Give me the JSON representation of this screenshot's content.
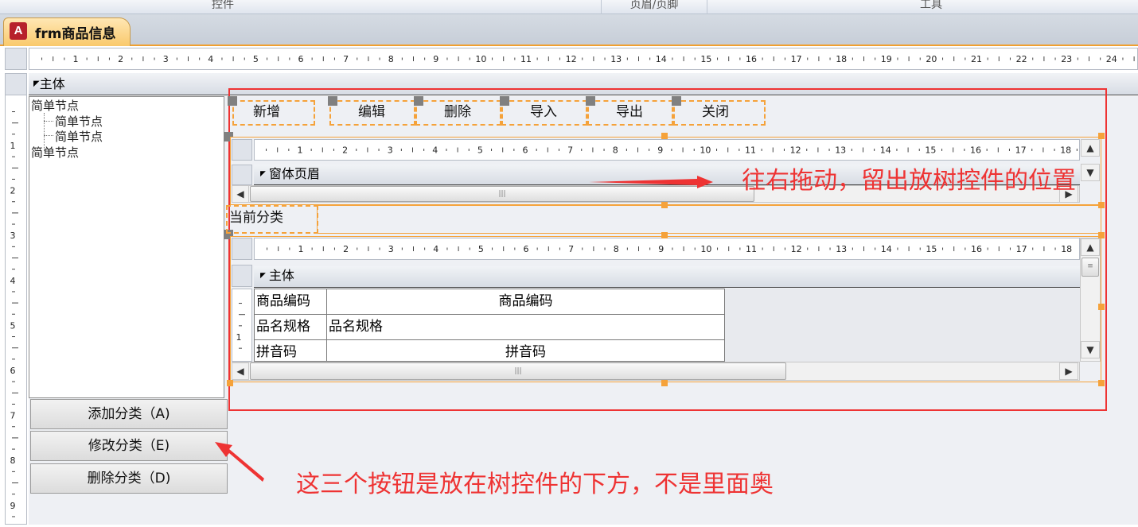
{
  "ribbon": {
    "groups": [
      "控件",
      "页眉/页脚",
      "工具"
    ]
  },
  "document_tab": {
    "icon_letter": "A",
    "title": "frm商品信息"
  },
  "form": {
    "section_label": "主体",
    "ruler_numbers": [
      "1",
      "2",
      "3",
      "4",
      "5",
      "6",
      "7",
      "8",
      "9",
      "10",
      "11",
      "12",
      "13",
      "14",
      "15",
      "16",
      "17",
      "18",
      "19",
      "20",
      "21",
      "22",
      "23",
      "24"
    ],
    "vruler_numbers": [
      "1",
      "2",
      "3",
      "4",
      "5",
      "6",
      "7",
      "8",
      "9"
    ]
  },
  "tree": {
    "nodes": [
      "简单节点",
      "简单节点",
      "简单节点",
      "简单节点"
    ]
  },
  "category_buttons": [
    "添加分类（A)",
    "修改分类（E)",
    "删除分类（D)"
  ],
  "toolbar_buttons": [
    "新增",
    "编辑",
    "删除",
    "导入",
    "导出",
    "关闭"
  ],
  "subform_header": {
    "section_label": "窗体页眉",
    "ruler_numbers": [
      "1",
      "2",
      "3",
      "4",
      "5",
      "6",
      "7",
      "8",
      "9",
      "10",
      "11",
      "12",
      "13",
      "14",
      "15",
      "16",
      "17",
      "18"
    ]
  },
  "current_category_label": "当前分类",
  "subform_detail": {
    "section_label": "主体",
    "ruler_numbers": [
      "1",
      "2",
      "3",
      "4",
      "5",
      "6",
      "7",
      "8",
      "9",
      "10",
      "11",
      "12",
      "13",
      "14",
      "15",
      "16",
      "17",
      "18"
    ],
    "vruler_number": "1",
    "rows": [
      {
        "label": "商品编码",
        "field": "商品编码",
        "align": "center"
      },
      {
        "label": "品名规格",
        "field": "品名规格",
        "align": "left"
      },
      {
        "label": "拼音码",
        "field": "拼音码",
        "align": "center"
      }
    ]
  },
  "annotations": {
    "drag_note": "往右拖动，留出放树控件的位置",
    "buttons_note": "这三个按钮是放在树控件的下方，不是里面奥",
    "color": "#ee3333"
  },
  "colors": {
    "design_handle": "#f5a23a",
    "annotation": "#ee3333",
    "tab_accent": "#f9c96c"
  }
}
